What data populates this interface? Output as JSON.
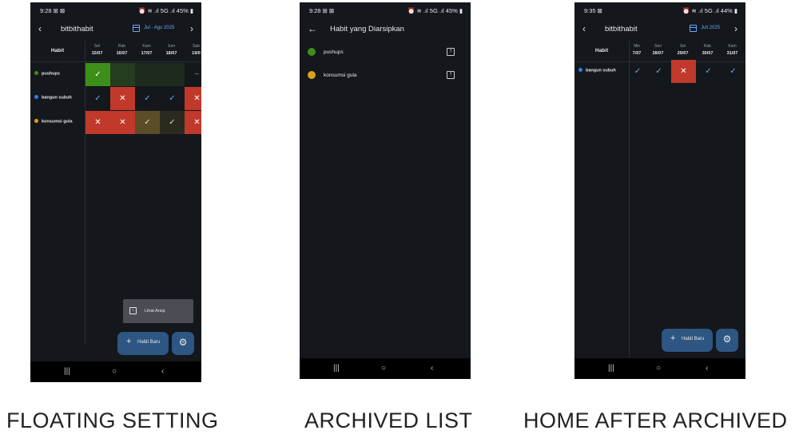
{
  "screens": [
    {
      "status": {
        "time": "9:28 ⊞ ⊠",
        "icons": "⏰ ≋ .ıl 5G .ıl 45% ▮"
      },
      "appbar": {
        "back": "‹",
        "title": "bitbithabit",
        "range": "Jul - Agu 2025",
        "next": "›"
      },
      "grid": {
        "habit_header": "Habit",
        "days": [
          {
            "dow": "Sel",
            "date": "15/07"
          },
          {
            "dow": "Rab",
            "date": "16/07"
          },
          {
            "dow": "Kam",
            "date": "17/07"
          },
          {
            "dow": "Jum",
            "date": "18/07"
          },
          {
            "dow": "Sab",
            "date": "19/0"
          }
        ],
        "rows": [
          {
            "name": "pushups",
            "color": "#3e8e1a",
            "cells": [
              "✓",
              "",
              "",
              "",
              "~"
            ]
          },
          {
            "name": "bangun subuh",
            "color": "#2f80ed",
            "cells": [
              "✓",
              "✕",
              "✓",
              "✓",
              "✕"
            ]
          },
          {
            "name": "konsumsi gula",
            "color": "#d9a21b",
            "cells": [
              "✕",
              "✕",
              "✓",
              "✓",
              "✕"
            ]
          }
        ]
      },
      "menu": {
        "icon": "archive-icon",
        "label": "Lihat Arsip"
      },
      "new_habit": {
        "plus": "+",
        "label": "Habit Baru"
      },
      "settings": {
        "icon": "gear-icon",
        "glyph": "⚙"
      },
      "nav": {
        "recent": "|||",
        "home": "○",
        "back": "‹"
      }
    },
    {
      "status": {
        "time": "9:28 ⊞ ⊠",
        "icons": "⏰ ≋ .ıl 5G .ıl 45% ▮"
      },
      "appbar": {
        "back": "←",
        "title": "Habit yang Diarsipkan"
      },
      "items": [
        {
          "name": "pushups",
          "color": "#3e8e1a",
          "action_icon": "unarchive-icon",
          "glyph": "⇡"
        },
        {
          "name": "konsumsi gula",
          "color": "#d9a21b",
          "action_icon": "unarchive-icon",
          "glyph": "⇡"
        }
      ],
      "nav": {
        "recent": "|||",
        "home": "○",
        "back": "‹"
      }
    },
    {
      "status": {
        "time": "9:35 ⊠",
        "icons": "⏰ ≋ .ıl 5G .ıl 44% ▮"
      },
      "appbar": {
        "back": "‹",
        "title": "bitbithabit",
        "range": "Juli 2025",
        "next": "›"
      },
      "grid": {
        "habit_header": "Habit",
        "days": [
          {
            "dow": "Min",
            "date": "7/07"
          },
          {
            "dow": "Sen",
            "date": "28/07"
          },
          {
            "dow": "Sel",
            "date": "29/07"
          },
          {
            "dow": "Rab",
            "date": "30/07"
          },
          {
            "dow": "Kam",
            "date": "31/07"
          }
        ],
        "rows": [
          {
            "name": "bangun subuh",
            "color": "#2f80ed",
            "cells": [
              "✓",
              "✓",
              "✕",
              "✓",
              "✓"
            ]
          }
        ]
      },
      "new_habit": {
        "plus": "+",
        "label": "Habit Baru"
      },
      "settings": {
        "icon": "gear-icon",
        "glyph": "⚙"
      },
      "nav": {
        "recent": "|||",
        "home": "○",
        "back": "‹"
      }
    }
  ],
  "captions": [
    "FLOATING SETTING",
    "ARCHIVED LIST",
    "HOME AFTER ARCHIVED"
  ]
}
